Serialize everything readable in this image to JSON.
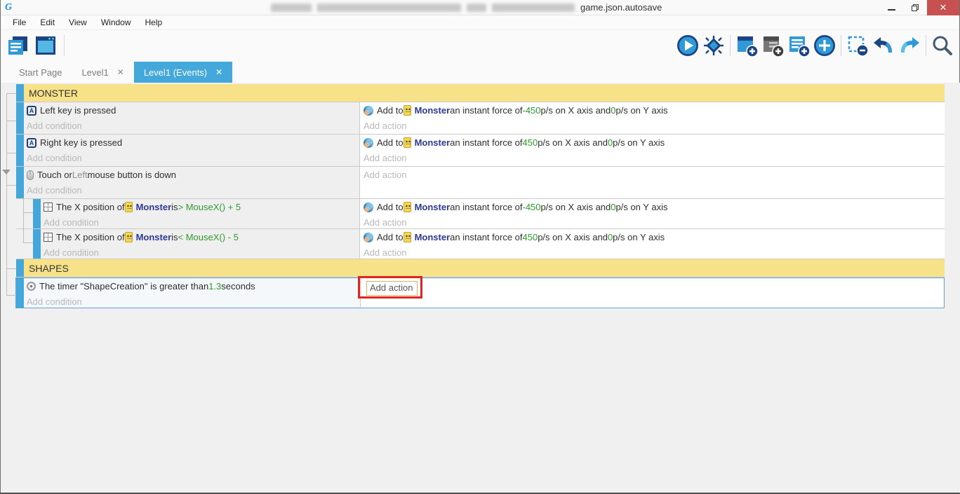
{
  "window": {
    "title": "game.json.autosave",
    "controls": {
      "minimize": "",
      "restore": "",
      "close_glyph": "✕"
    }
  },
  "menu": {
    "items": [
      {
        "label": "File"
      },
      {
        "label": "Edit"
      },
      {
        "label": "View"
      },
      {
        "label": "Window"
      },
      {
        "label": "Help"
      }
    ]
  },
  "toolbar": {
    "left_icons": [
      "project-manager-icon",
      "scene-editor-icon"
    ],
    "right_icons": [
      "play-icon",
      "debug-icon",
      "add-event-icon",
      "add-subevent-icon",
      "add-comment-icon",
      "add-circle-icon",
      "remove-event-icon",
      "undo-icon",
      "redo-icon",
      "search-icon"
    ],
    "accent_blue": "#2f9ad6",
    "accent_navy": "#1c4383"
  },
  "tabs": [
    {
      "label": "Start Page",
      "active": false,
      "closable": false,
      "close_glyph": ""
    },
    {
      "label": "Level1",
      "active": false,
      "closable": true,
      "close_glyph": "✕"
    },
    {
      "label": "Level1 (Events)",
      "active": true,
      "closable": true,
      "close_glyph": "✕"
    }
  ],
  "events": {
    "groups": [
      "MONSTER",
      "SHAPES"
    ],
    "placeholders": {
      "condition": "Add condition",
      "action": "Add action"
    },
    "colors": {
      "group_bg": "#f8e289",
      "event_bar": "#45a7d9",
      "value_green": "#2f9b2f",
      "object_navy": "#2c3a94",
      "selected_border": "#59a6d6"
    },
    "rows": {
      "ev1": {
        "condition": {
          "segments": [
            {
              "icon": "keyboard-a-icon"
            },
            {
              "t": "Left key is pressed",
              "k": "plain"
            }
          ]
        },
        "action": {
          "segments": [
            {
              "icon": "force-icon"
            },
            {
              "t": "Add to ",
              "k": "plain"
            },
            {
              "icon": "monster-object-icon"
            },
            {
              "t": "Monster",
              "k": "object"
            },
            {
              "t": "  an instant  force of ",
              "k": "plain"
            },
            {
              "t": "-450",
              "k": "value"
            },
            {
              "t": " p/s on X axis and ",
              "k": "plain"
            },
            {
              "t": "0",
              "k": "value"
            },
            {
              "t": " p/s on Y axis",
              "k": "plain"
            }
          ]
        }
      },
      "ev2": {
        "condition": {
          "segments": [
            {
              "icon": "keyboard-a-icon"
            },
            {
              "t": "Right key is pressed",
              "k": "plain"
            }
          ]
        },
        "action": {
          "segments": [
            {
              "icon": "force-icon"
            },
            {
              "t": "Add to ",
              "k": "plain"
            },
            {
              "icon": "monster-object-icon"
            },
            {
              "t": "Monster",
              "k": "object"
            },
            {
              "t": "  an instant  force of ",
              "k": "plain"
            },
            {
              "t": "450",
              "k": "value"
            },
            {
              "t": " p/s on X axis and ",
              "k": "plain"
            },
            {
              "t": "0",
              "k": "value"
            },
            {
              "t": " p/s on Y axis",
              "k": "plain"
            }
          ]
        }
      },
      "ev3": {
        "condition": {
          "segments": [
            {
              "icon": "mouse-icon"
            },
            {
              "t": "Touch or ",
              "k": "plain"
            },
            {
              "t": "Left",
              "k": "param"
            },
            {
              "t": " mouse button is down",
              "k": "plain"
            }
          ]
        }
      },
      "sub1": {
        "condition": {
          "segments": [
            {
              "icon": "position-icon"
            },
            {
              "t": "The X position of ",
              "k": "plain"
            },
            {
              "icon": "monster-object-icon"
            },
            {
              "t": "Monster",
              "k": "object"
            },
            {
              "t": " is ",
              "k": "plain"
            },
            {
              "t": "> MouseX() + 5",
              "k": "value"
            }
          ]
        },
        "action": {
          "segments": [
            {
              "icon": "force-icon"
            },
            {
              "t": "Add to ",
              "k": "plain"
            },
            {
              "icon": "monster-object-icon"
            },
            {
              "t": "Monster",
              "k": "object"
            },
            {
              "t": "  an instant  force of ",
              "k": "plain"
            },
            {
              "t": "-450",
              "k": "value"
            },
            {
              "t": " p/s on X axis and ",
              "k": "plain"
            },
            {
              "t": "0",
              "k": "value"
            },
            {
              "t": " p/s on Y axis",
              "k": "plain"
            }
          ]
        }
      },
      "sub2": {
        "condition": {
          "segments": [
            {
              "icon": "position-icon"
            },
            {
              "t": "The X position of ",
              "k": "plain"
            },
            {
              "icon": "monster-object-icon"
            },
            {
              "t": "Monster",
              "k": "object"
            },
            {
              "t": " is ",
              "k": "plain"
            },
            {
              "t": "< MouseX() - 5",
              "k": "value"
            }
          ]
        },
        "action": {
          "segments": [
            {
              "icon": "force-icon"
            },
            {
              "t": "Add to ",
              "k": "plain"
            },
            {
              "icon": "monster-object-icon"
            },
            {
              "t": "Monster",
              "k": "object"
            },
            {
              "t": "  an instant  force of ",
              "k": "plain"
            },
            {
              "t": "450",
              "k": "value"
            },
            {
              "t": " p/s on X axis and ",
              "k": "plain"
            },
            {
              "t": "0",
              "k": "value"
            },
            {
              "t": " p/s on Y axis",
              "k": "plain"
            }
          ]
        }
      },
      "timer": {
        "condition": {
          "segments": [
            {
              "icon": "timer-icon"
            },
            {
              "t": "The timer \"ShapeCreation\" is greater than ",
              "k": "plain"
            },
            {
              "t": "1.3",
              "k": "value"
            },
            {
              "t": " seconds",
              "k": "plain"
            }
          ]
        },
        "focused_action_label": "Add action"
      }
    }
  },
  "annotation": {
    "type": "red-rectangle",
    "around": "Add action"
  }
}
